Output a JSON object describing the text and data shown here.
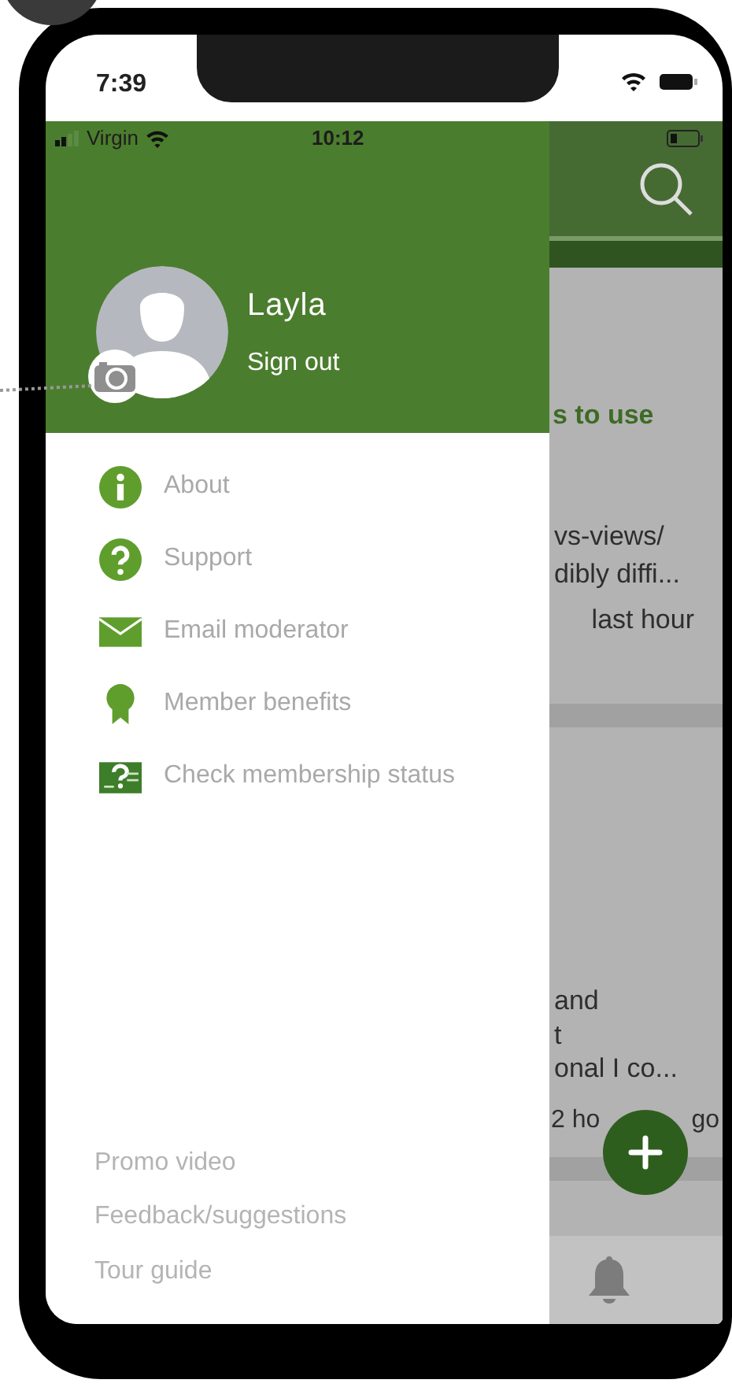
{
  "phone_status_bar": {
    "time": "7:39"
  },
  "app_status_bar": {
    "carrier": "Virgin",
    "time": "10:12"
  },
  "drawer": {
    "profile": {
      "name": "Layla",
      "sign_out": "Sign out"
    },
    "menu": [
      {
        "kind": "info",
        "label": "About"
      },
      {
        "kind": "question",
        "label": "Support"
      },
      {
        "kind": "mail",
        "label": "Email moderator"
      },
      {
        "kind": "award",
        "label": "Member benefits"
      },
      {
        "kind": "status",
        "label": "Check membership status"
      }
    ],
    "footer_links": [
      "Promo video",
      "Feedback/suggestions",
      "Tour guide"
    ]
  },
  "background_content": {
    "posts": [
      {
        "title": "s to use",
        "lines": [
          "vs-views/",
          "dibly diffi..."
        ],
        "time": [
          "last hour"
        ]
      },
      {
        "lines": [
          "and",
          "t",
          "onal I co..."
        ],
        "time": [
          "2 ho",
          "go"
        ]
      }
    ]
  }
}
